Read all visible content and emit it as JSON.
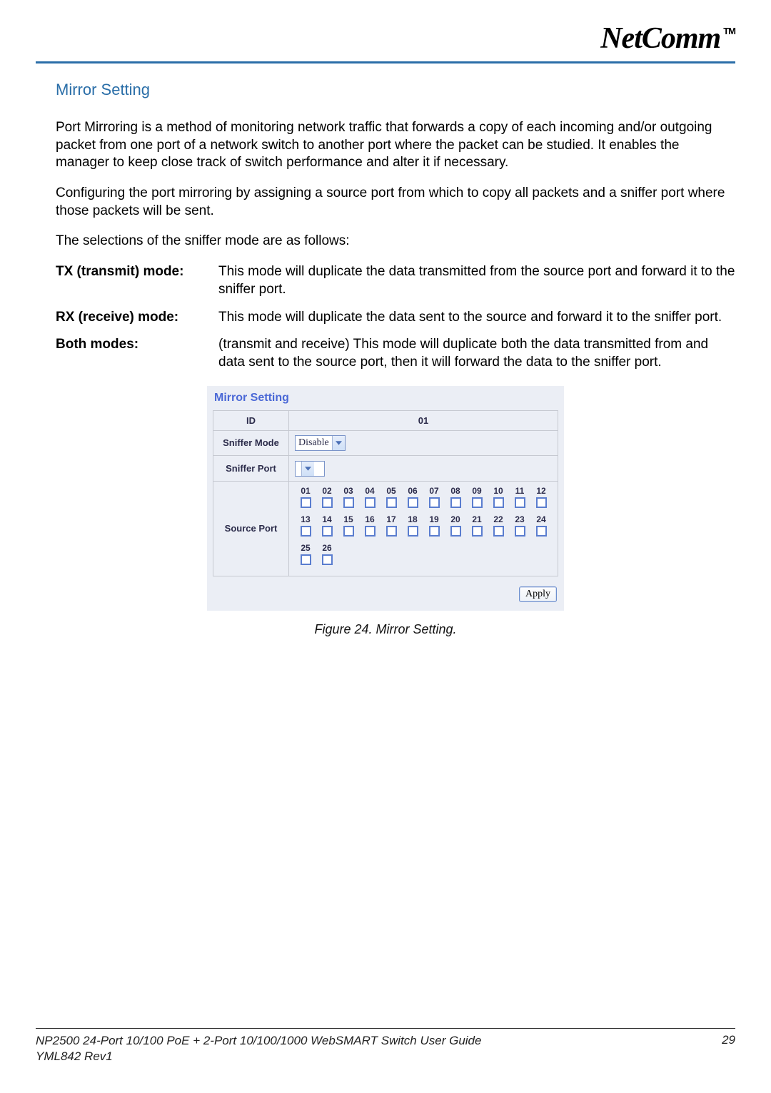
{
  "brand": {
    "name": "NetComm",
    "tm": "TM"
  },
  "section_title": "Mirror Setting",
  "paragraphs": {
    "p1": "Port Mirroring is a method of monitoring network traffic that forwards a copy of each incoming and/or outgoing packet from one port of a network switch to another port where the packet can be studied. It enables the manager to keep close track of switch performance and alter it if necessary.",
    "p2": "Configuring the port mirroring by assigning a source port from which to copy all packets and a sniffer port where those packets will be sent.",
    "p3": "The selections of the sniffer mode are as follows:"
  },
  "modes": {
    "tx": {
      "label": "TX (transmit) mode:",
      "desc": "This mode will duplicate the data transmitted from the source port and forward it to the sniffer port."
    },
    "rx": {
      "label": "RX (receive) mode:",
      "desc": "This mode will duplicate the data sent to the source and forward it to the sniffer port."
    },
    "both": {
      "label": "Both modes:",
      "desc": "(transmit and receive) This mode will duplicate both the data transmitted from and data sent to the source port, then it will forward the data to the sniffer port."
    }
  },
  "ui": {
    "title": "Mirror Setting",
    "id_label": "ID",
    "id_value": "01",
    "sniffer_mode_label": "Sniffer Mode",
    "sniffer_mode_value": "Disable",
    "sniffer_port_label": "Sniffer Port",
    "sniffer_port_value": "",
    "source_port_label": "Source Port",
    "ports_row1": [
      "01",
      "02",
      "03",
      "04",
      "05",
      "06",
      "07",
      "08",
      "09",
      "10",
      "11",
      "12"
    ],
    "ports_row2": [
      "13",
      "14",
      "15",
      "16",
      "17",
      "18",
      "19",
      "20",
      "21",
      "22",
      "23",
      "24"
    ],
    "ports_row3": [
      "25",
      "26"
    ],
    "apply_label": "Apply"
  },
  "figure_caption": "Figure 24. Mirror Setting.",
  "footer": {
    "line1": "NP2500 24-Port 10/100 PoE + 2-Port 10/100/1000 WebSMART Switch User Guide",
    "line2": "YML842 Rev1",
    "page": "29"
  }
}
